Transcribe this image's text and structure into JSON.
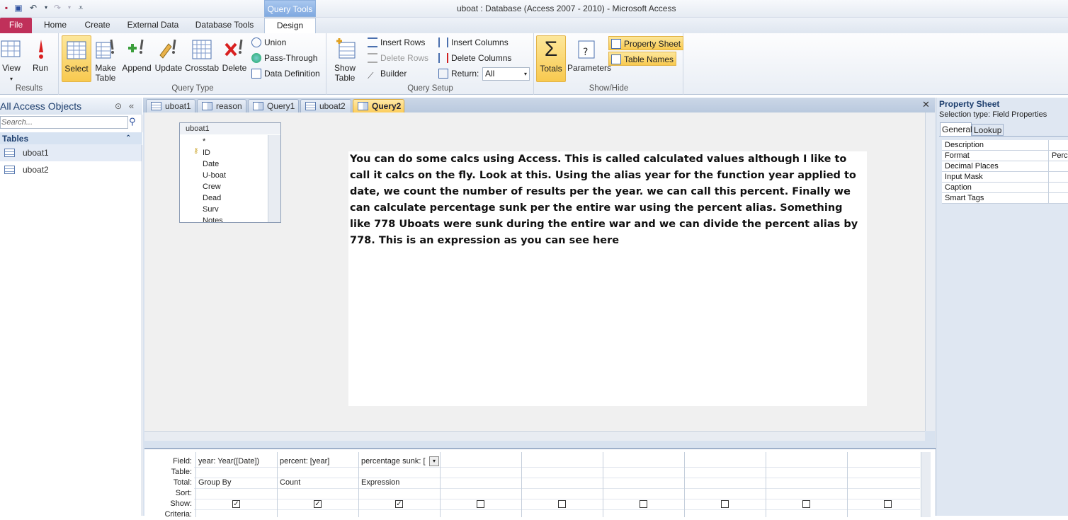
{
  "window": {
    "title": "uboat : Database (Access 2007 - 2010)  -  Microsoft Access",
    "context_tab": "Query Tools"
  },
  "tabs": {
    "file": "File",
    "home": "Home",
    "create": "Create",
    "external": "External Data",
    "dbtools": "Database Tools",
    "design": "Design"
  },
  "ribbon": {
    "results": {
      "label": "Results",
      "view": "View",
      "run": "Run"
    },
    "querytype": {
      "label": "Query Type",
      "select": "Select",
      "make_table_1": "Make",
      "make_table_2": "Table",
      "append": "Append",
      "update": "Update",
      "crosstab": "Crosstab",
      "delete": "Delete",
      "union": "Union",
      "passthrough": "Pass-Through",
      "datadef": "Data Definition"
    },
    "setup": {
      "label": "Query Setup",
      "show_table_1": "Show",
      "show_table_2": "Table",
      "insert_rows": "Insert Rows",
      "delete_rows": "Delete Rows",
      "builder": "Builder",
      "insert_columns": "Insert Columns",
      "delete_columns": "Delete Columns",
      "return_label": "Return:",
      "return_value": "All"
    },
    "showhide": {
      "label": "Show/Hide",
      "totals": "Totals",
      "parameters": "Parameters",
      "property_sheet": "Property Sheet",
      "table_names": "Table Names"
    }
  },
  "nav": {
    "header": "All Access Objects",
    "search_placeholder": "Search...",
    "section": "Tables",
    "items": [
      "uboat1",
      "uboat2"
    ]
  },
  "doctabs": [
    "uboat1",
    "reason",
    "Query1",
    "uboat2",
    "Query2"
  ],
  "fieldlist": {
    "title": "uboat1",
    "fields": [
      "*",
      "ID",
      "Date",
      "U-boat",
      "Crew",
      "Dead",
      "Surv",
      "Notes"
    ]
  },
  "annotation": "You can do some calcs using Access. This is called calculated values although I like to call it calcs on the fly. Look at this. Using the alias year for the function year applied to date, we count the number of results per the year.  we can call this percent. Finally we can calculate percentage sunk per the entire war using the percent alias. Something like 778 Uboats were sunk during the entire war and we can divide the percent alias by 778. This is an expression as you can see here",
  "grid": {
    "row_labels": {
      "field": "Field:",
      "table": "Table:",
      "total": "Total:",
      "sort": "Sort:",
      "show": "Show:",
      "criteria": "Criteria:"
    },
    "columns": [
      {
        "field": "year: Year([Date])",
        "total": "Group By",
        "show": true
      },
      {
        "field": "percent: [year]",
        "total": "Count",
        "show": true
      },
      {
        "field": "percentage sunk: [",
        "total": "Expression",
        "show": true
      }
    ]
  },
  "property_sheet": {
    "title": "Property Sheet",
    "selection_type": "Selection type:  Field Properties",
    "tab_general": "General",
    "tab_lookup": "Lookup",
    "rows": [
      {
        "name": "Description",
        "value": ""
      },
      {
        "name": "Format",
        "value": "Percent"
      },
      {
        "name": "Decimal Places",
        "value": ""
      },
      {
        "name": "Input Mask",
        "value": ""
      },
      {
        "name": "Caption",
        "value": ""
      },
      {
        "name": "Smart Tags",
        "value": ""
      }
    ]
  }
}
